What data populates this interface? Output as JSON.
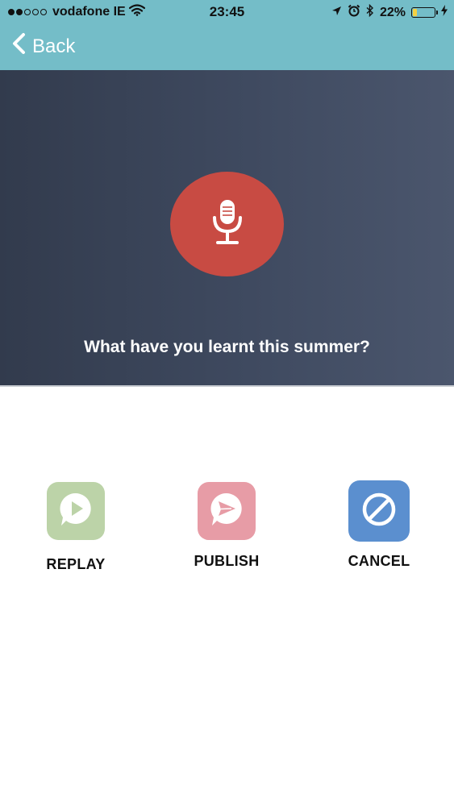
{
  "status_bar": {
    "carrier": "vodafone IE",
    "time": "23:45",
    "battery": "22%",
    "battery_level": 0.22,
    "signal_dots_filled": 2,
    "signal_dots_total": 5
  },
  "nav": {
    "back_label": "Back"
  },
  "recording": {
    "question": "What have you learnt this summer?"
  },
  "actions": {
    "replay_label": "REPLAY",
    "publish_label": "PUBLISH",
    "cancel_label": "CANCEL"
  },
  "colors": {
    "header": "#74bdc8",
    "mic": "#c84b43",
    "replay": "#bcd3a8",
    "publish": "#e79ca6",
    "cancel": "#5b8fcf"
  },
  "icons": {
    "mic": "microphone-icon",
    "replay": "play-bubble-icon",
    "publish": "send-bubble-icon",
    "cancel": "no-entry-icon"
  }
}
